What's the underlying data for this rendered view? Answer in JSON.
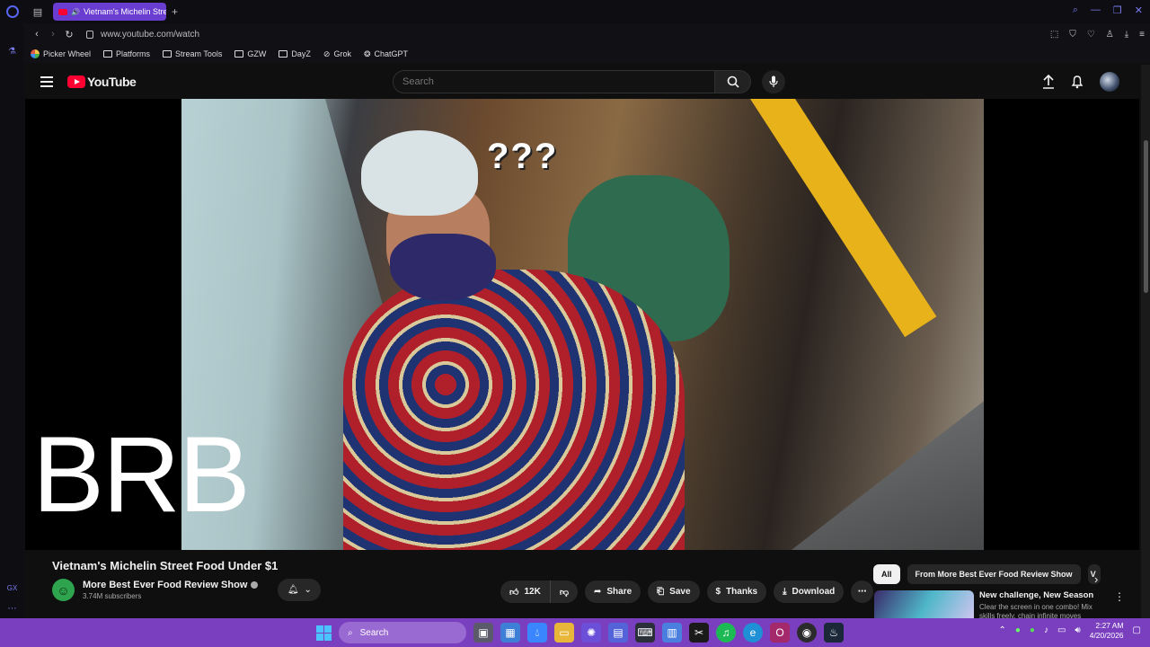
{
  "browser": {
    "tab_title": "Vietnam's Michelin Stre",
    "url": "www.youtube.com/watch",
    "bookmarks": [
      {
        "label": "Picker Wheel"
      },
      {
        "label": "Platforms"
      },
      {
        "label": "Stream Tools"
      },
      {
        "label": "GZW"
      },
      {
        "label": "DayZ"
      },
      {
        "label": "Grok"
      },
      {
        "label": "ChatGPT"
      }
    ],
    "sidebar_label": "GX"
  },
  "youtube": {
    "logo_text": "YouTube",
    "search_placeholder": "Search",
    "overlay_text": "BRB",
    "video_caption": "???",
    "video": {
      "title": "Vietnam's Michelin Street Food Under $1",
      "channel_name": "More Best Ever Food Review Show",
      "subscribers": "3.74M subscribers",
      "likes": "12K",
      "share_label": "Share",
      "save_label": "Save",
      "thanks_label": "Thanks",
      "download_label": "Download"
    },
    "chips": [
      "All",
      "From More Best Ever Food Review Show",
      "V"
    ],
    "recommendation": {
      "title": "New challenge, New Season",
      "description": "Clear the screen in one combo! Mix skills freely, chain infinite moves"
    }
  },
  "taskbar": {
    "search_label": "Search",
    "time": "2:27 AM",
    "date": "4/20/2026"
  },
  "colors": {
    "youtube_red": "#ff0033",
    "opera_accent": "#6a3dd1",
    "taskbar": "#7a3fbf"
  }
}
